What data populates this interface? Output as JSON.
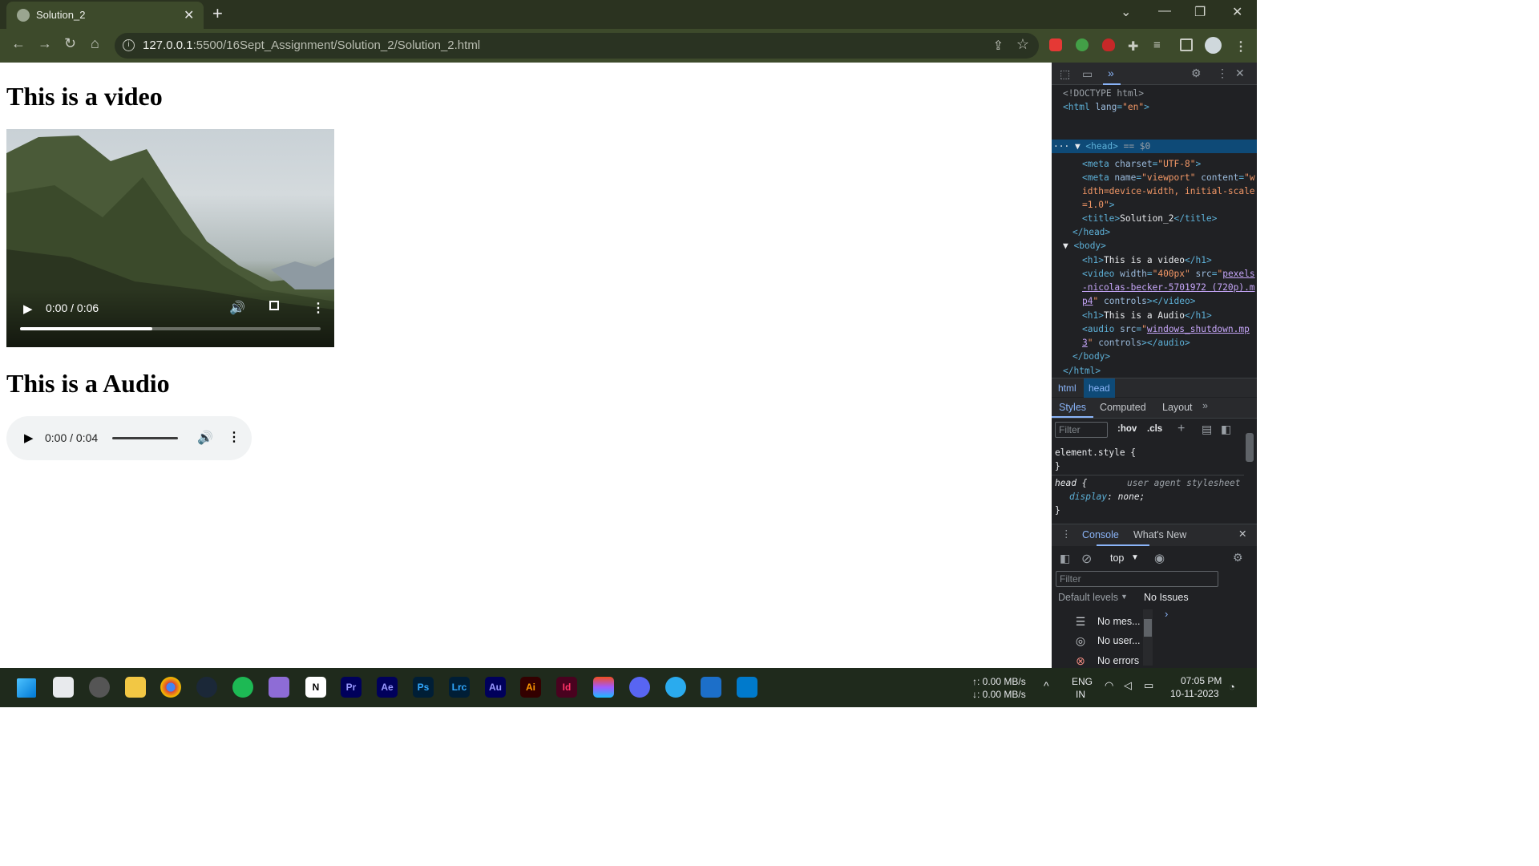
{
  "browser": {
    "tab_title": "Solution_2",
    "url_host": "127.0.0.1",
    "url_rest": ":5500/16Sept_Assignment/Solution_2/Solution_2.html"
  },
  "page": {
    "video_heading": "This is a video",
    "audio_heading": "This is a Audio",
    "video": {
      "time": "0:00 / 0:06",
      "buffered_fraction": 0.44
    },
    "audio": {
      "time": "0:00 / 0:04"
    }
  },
  "devtools": {
    "breadcrumbs": [
      "html",
      "head"
    ],
    "style_tabs": [
      "Styles",
      "Computed",
      "Layout"
    ],
    "filter_placeholder": "Filter",
    "hov": ":hov",
    "cls": ".cls",
    "rule1_selector": "element.style {",
    "rule1_close": "}",
    "rule2_selector": "head {",
    "rule2_source": "user agent stylesheet",
    "rule2_prop": "display",
    "rule2_value": "none;",
    "rule2_close": "}",
    "drawer_tabs": [
      "Console",
      "What's New"
    ],
    "context": "top",
    "default_levels": "Default levels",
    "no_issues": "No Issues",
    "messages": [
      "No mes...",
      "No user...",
      "No errors"
    ],
    "selected_marker": "== $0"
  },
  "taskbar": {
    "net_up": "↑: 0.00 MB/s",
    "net_down": "↓: 0.00 MB/s",
    "lang1": "ENG",
    "lang2": "IN",
    "time": "07:05 PM",
    "date": "10-11-2023",
    "apps": [
      "Pr",
      "Ae",
      "Ps",
      "Lrc",
      "Au",
      "Ai",
      "Id"
    ]
  }
}
